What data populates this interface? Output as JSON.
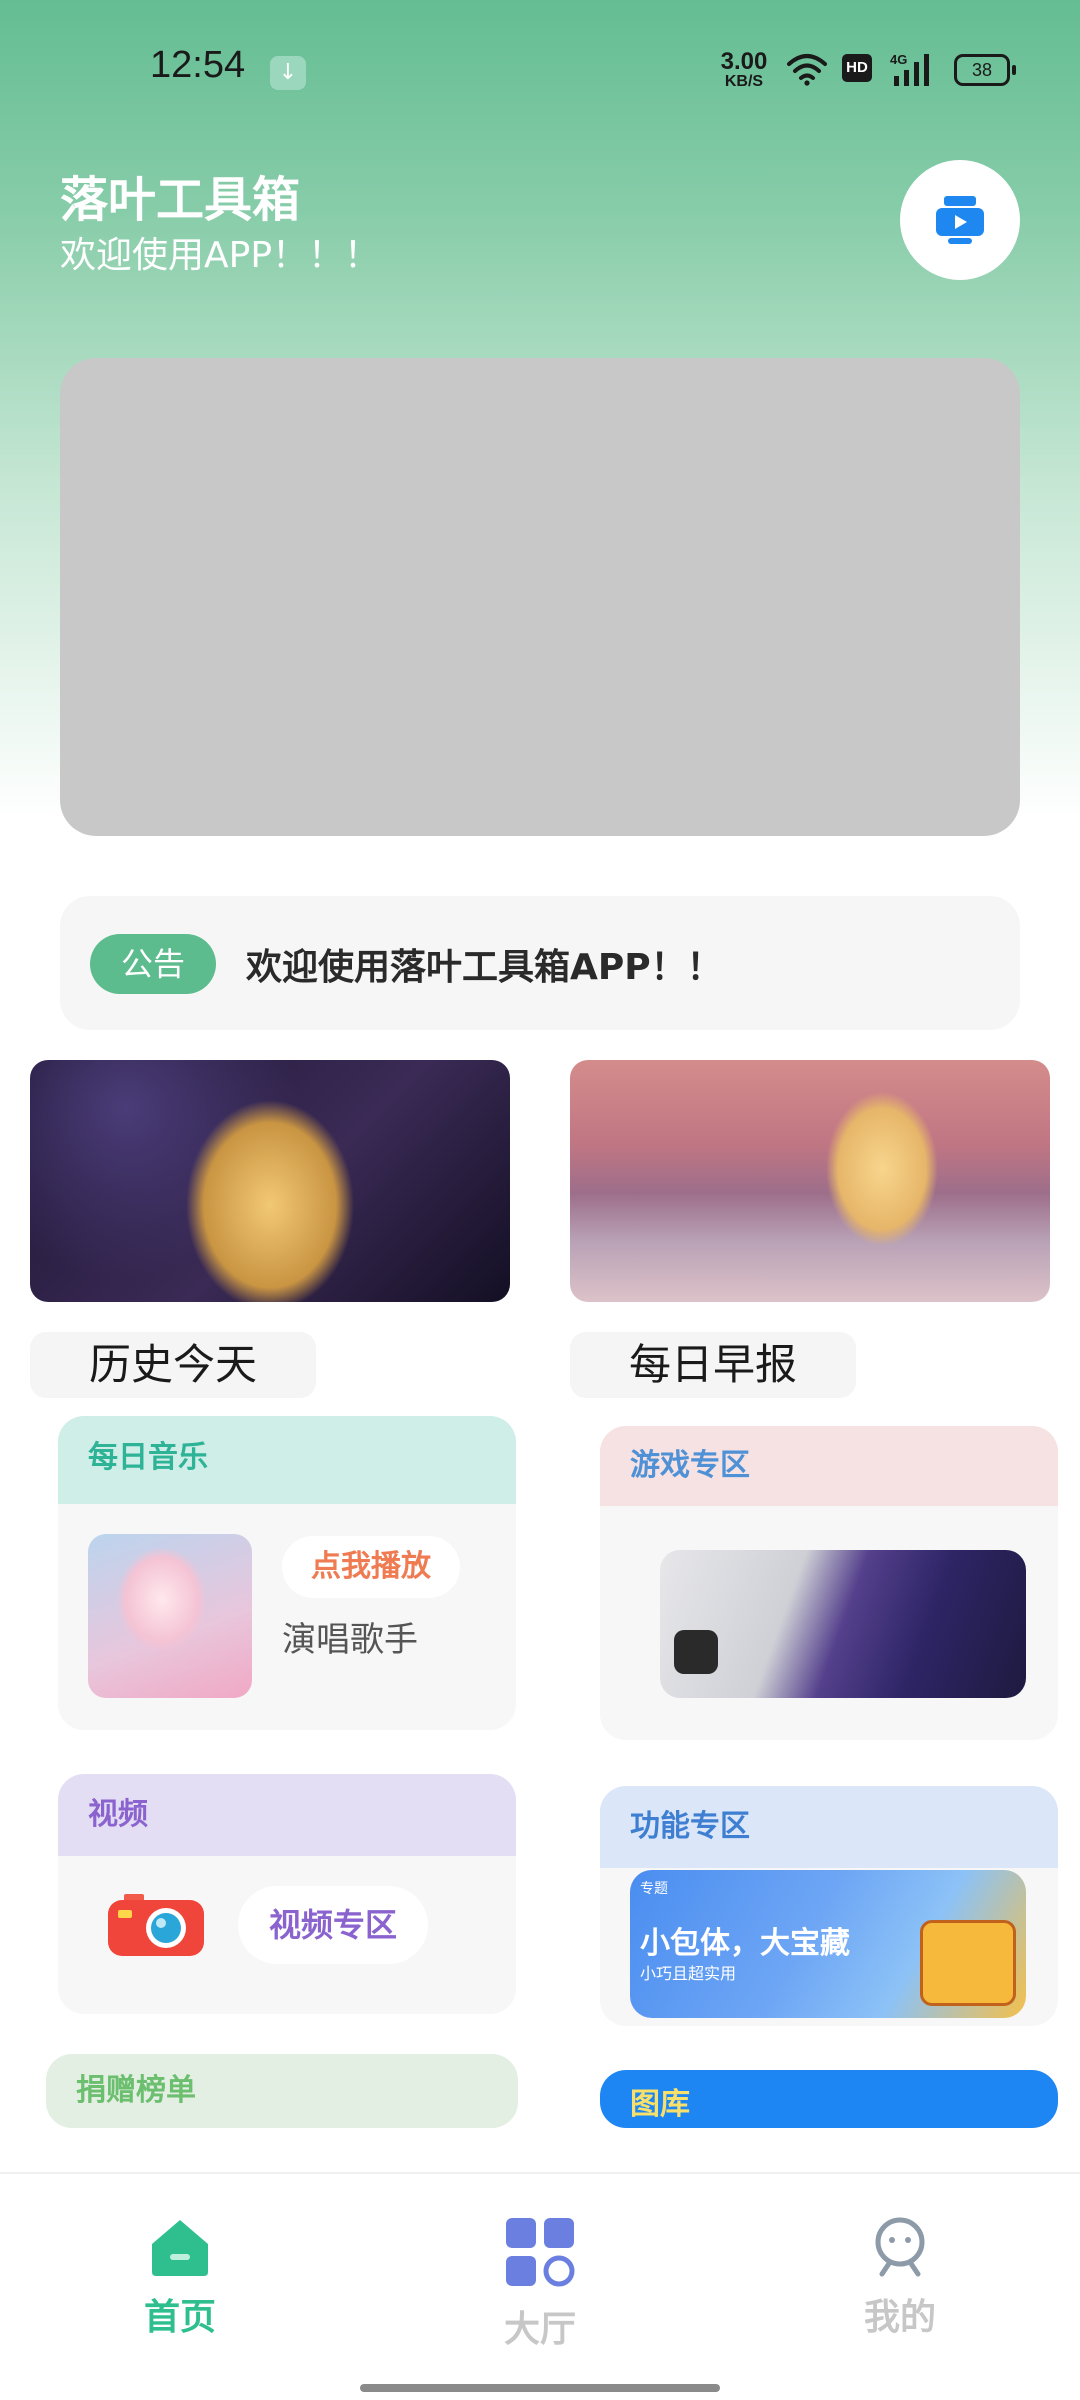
{
  "status_bar": {
    "time": "12:54",
    "download_icon": "download-icon",
    "net_speed_value": "3.00",
    "net_speed_unit": "KB/S",
    "hd_label": "HD",
    "network_label": "4G",
    "battery": "38"
  },
  "header": {
    "title": "落叶工具箱",
    "subtitle": "欢迎使用APP！！！",
    "action_icon": "video-camera-icon"
  },
  "notice": {
    "tag": "公告",
    "text": "欢迎使用落叶工具箱APP！！"
  },
  "image_cards": [
    {
      "caption": "历史今天"
    },
    {
      "caption": "每日早报"
    }
  ],
  "music_card": {
    "title": "每日音乐",
    "play_label": "点我播放",
    "singer": "演唱歌手"
  },
  "game_card": {
    "title": "游戏专区"
  },
  "video_card": {
    "title": "视频",
    "button_label": "视频专区"
  },
  "func_card": {
    "title": "功能专区",
    "promo_tag": "专题",
    "promo_title": "小包体，大宝藏",
    "promo_subtitle": "小巧且超实用"
  },
  "donate_card": {
    "title": "捐赠榜单"
  },
  "gallery_card": {
    "title": "图库"
  },
  "tabbar": {
    "items": [
      {
        "label": "首页",
        "icon": "home-icon",
        "active": true
      },
      {
        "label": "大厅",
        "icon": "grid-icon",
        "active": false
      },
      {
        "label": "我的",
        "icon": "profile-icon",
        "active": false
      }
    ]
  },
  "colors": {
    "brand": "#5cbc8d",
    "active_tab": "#2fbf8f",
    "inactive_tab": "#c7c7c7"
  }
}
